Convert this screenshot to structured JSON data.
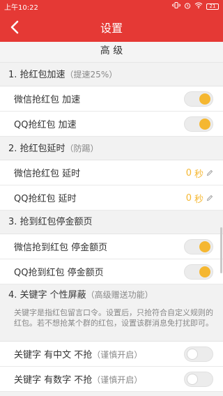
{
  "status": {
    "time": "上午10:22",
    "battery": "21",
    "icons": [
      "vibrate-icon",
      "alarm-icon",
      "wifi-icon",
      "battery-icon"
    ]
  },
  "header": {
    "title": "设置",
    "back_icon": "chevron-left-icon"
  },
  "section_title": "高 级",
  "groups": [
    {
      "title": "1. 抢红包加速",
      "note": "（提速25%）",
      "items": [
        {
          "label": "微信抢红包 加速",
          "type": "toggle",
          "on": true
        },
        {
          "label": "QQ抢红包 加速",
          "type": "toggle",
          "on": true
        }
      ]
    },
    {
      "title": "2. 抢红包延时",
      "note": "（防踢）",
      "items": [
        {
          "label": "微信抢红包 延时",
          "type": "delay",
          "value": "0",
          "unit": "秒"
        },
        {
          "label": "QQ抢红包 延时",
          "type": "delay",
          "value": "0",
          "unit": "秒"
        }
      ]
    },
    {
      "title": "3. 抢到红包停金额页",
      "note": "",
      "items": [
        {
          "label": "微信抢到红包 停金额页",
          "type": "toggle",
          "on": true
        },
        {
          "label": "QQ抢到红包 停金额页",
          "type": "toggle",
          "on": true
        }
      ]
    },
    {
      "title": "4. 关键字 个性屏蔽",
      "note": "（高级赠送功能）",
      "description": "关键字是指红包留言口令。设置后，只抢符合自定义规则的红包。若不想抢某个群的红包，设置该群消息免打扰即可。",
      "items": [
        {
          "label": "关键字 有中文 不抢",
          "note": "（谨慎开启）",
          "type": "toggle",
          "on": false
        },
        {
          "label": "关键字 有数字 不抢",
          "note": "（谨慎开启）",
          "type": "toggle",
          "on": false
        }
      ]
    }
  ],
  "colors": {
    "accent": "#e53935",
    "toggle_on": "#f5b731",
    "delay_value": "#f5b731"
  }
}
